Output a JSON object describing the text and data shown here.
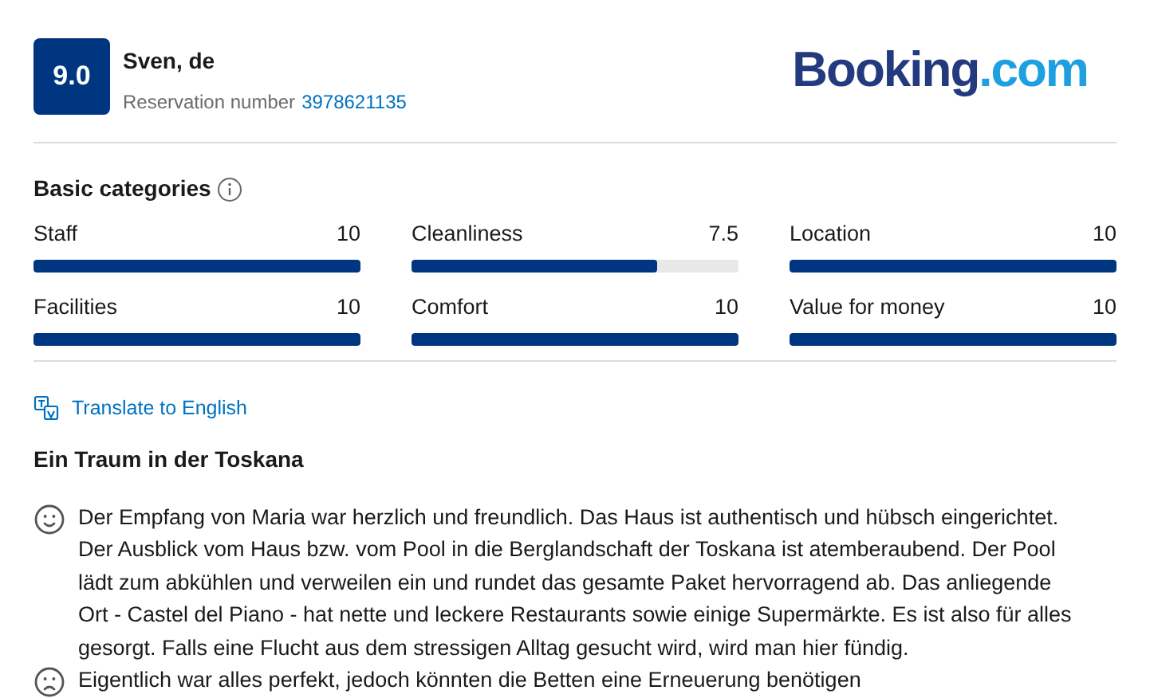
{
  "header": {
    "score": "9.0",
    "reviewer": "Sven, de",
    "reservation_label": "Reservation number",
    "reservation_number": "3978621135",
    "logo": {
      "main": "Booking",
      "suffix": ".com"
    }
  },
  "categories": {
    "title": "Basic categories",
    "items": [
      {
        "label": "Staff",
        "value": "10",
        "level": 1
      },
      {
        "label": "Cleanliness",
        "value": "7.5",
        "level": 0.75
      },
      {
        "label": "Location",
        "value": "10",
        "level": 1
      },
      {
        "label": "Facilities",
        "value": "10",
        "level": 1
      },
      {
        "label": "Comfort",
        "value": "10",
        "level": 1
      },
      {
        "label": "Value for money",
        "value": "10",
        "level": 1
      }
    ]
  },
  "translate_link": "Translate to English",
  "review": {
    "title": "Ein Traum in der Toskana",
    "comments": [
      {
        "kind": "positive",
        "text": "Der Empfang von Maria war herzlich und freundlich. Das Haus ist authentisch und hübsch eingerichtet. Der Ausblick vom Haus bzw. vom Pool in die Berglandschaft der Toskana ist atemberaubend. Der Pool lädt zum abkühlen und verweilen ein und rundet das gesamte Paket hervorragend ab. Das anliegende Ort - Castel del Piano - hat nette und leckere Restaurants sowie einige Supermärkte. Es ist also für alles gesorgt. Falls eine Flucht aus dem stressigen Alltag gesucht wird, wird man hier fündig."
      },
      {
        "kind": "negative",
        "text": "Eigentlich war alles perfekt, jedoch könnten die Betten eine Erneuerung benötigen"
      }
    ]
  }
}
